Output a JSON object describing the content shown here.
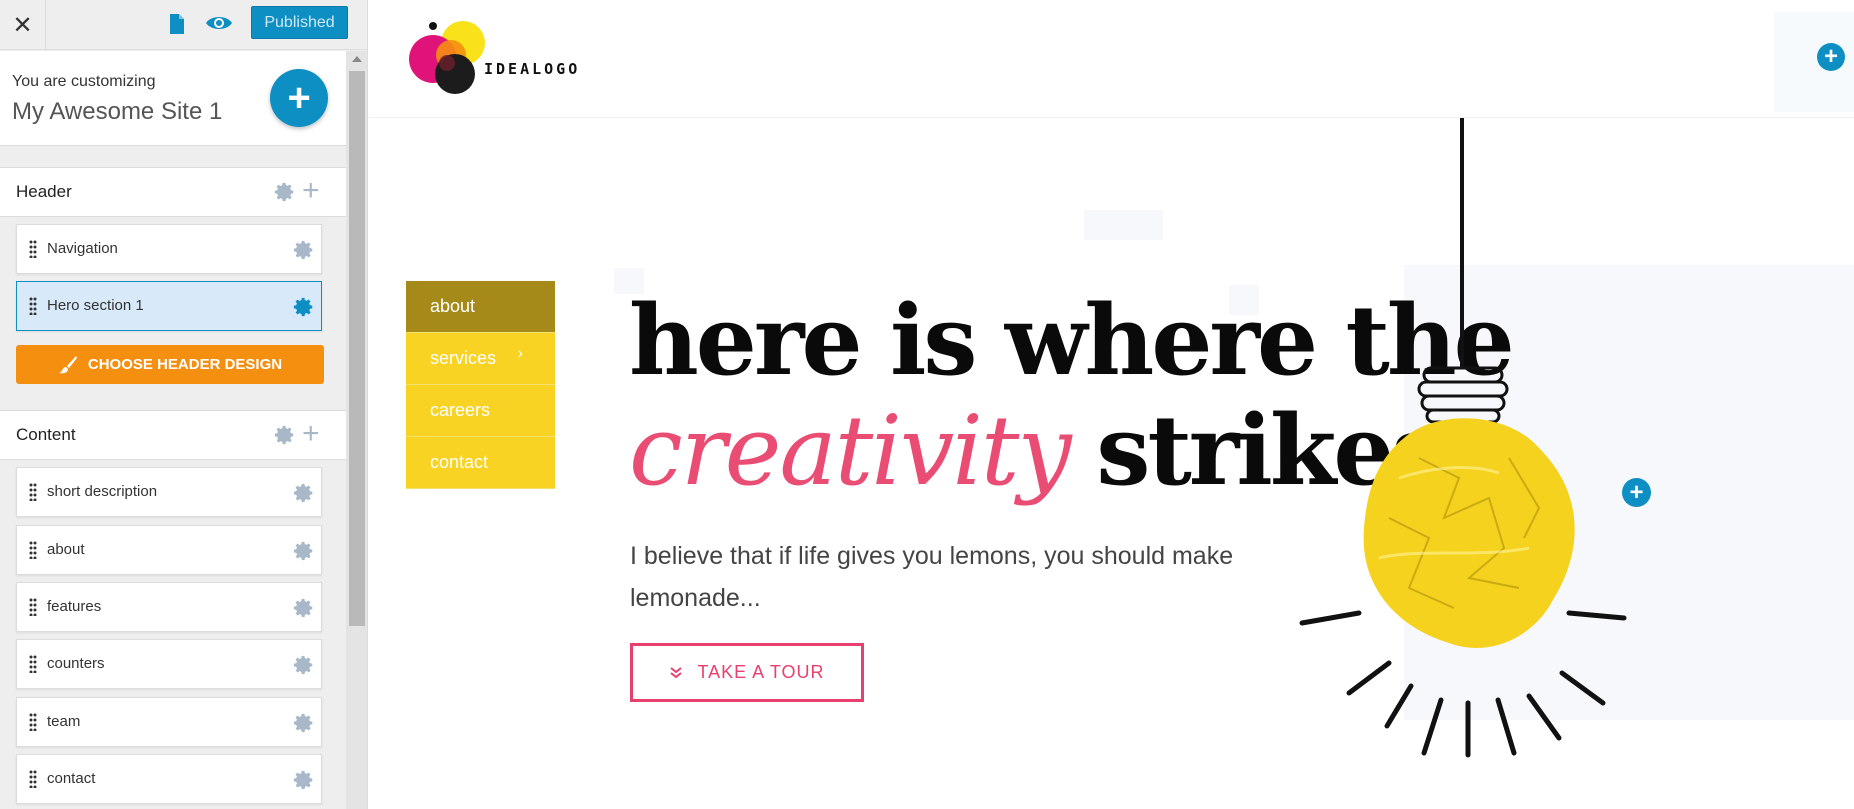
{
  "customizer": {
    "close_label": "✕",
    "published_label": "Published",
    "customizing_label": "You are customizing",
    "site_name": "My Awesome Site 1",
    "add_label": "+",
    "sections": [
      {
        "title": "Header",
        "items": [
          {
            "label": "Navigation"
          },
          {
            "label": "Hero section 1",
            "active": true
          }
        ],
        "button_label": "CHOOSE HEADER DESIGN"
      },
      {
        "title": "Content",
        "items": [
          {
            "label": "short description"
          },
          {
            "label": "about"
          },
          {
            "label": "features"
          },
          {
            "label": "counters"
          },
          {
            "label": "team"
          },
          {
            "label": "contact"
          }
        ]
      }
    ]
  },
  "preview": {
    "logo_text": "IDEALOGO",
    "menu": [
      {
        "label": "about",
        "active": true
      },
      {
        "label": "services",
        "has_submenu": true,
        "chevron": "›"
      },
      {
        "label": "careers"
      },
      {
        "label": "contact"
      }
    ],
    "headline_line1": "here is where the",
    "headline_highlight": "creativity",
    "headline_end": "strikes",
    "tagline": "I believe that if life gives you lemons, you should make lemonade...",
    "tour_button": "TAKE A TOUR",
    "tour_icon": "chevron-double-down-icon"
  },
  "colors": {
    "accent_blue": "#0d8fc4",
    "orange_button": "#f58f0f",
    "menu_yellow": "#f9d324",
    "menu_active": "#a58a19",
    "pink": "#e8406e"
  }
}
